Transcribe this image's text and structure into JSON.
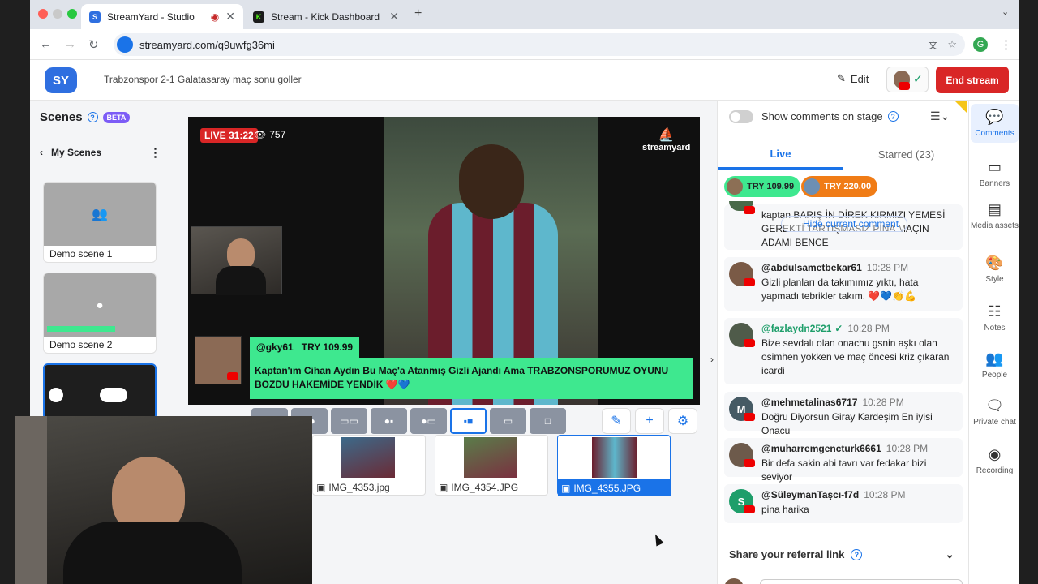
{
  "browser": {
    "tabs": [
      {
        "label": "StreamYard - Studio",
        "favicon": "S",
        "active": true
      },
      {
        "label": "Stream - Kick Dashboard",
        "favicon": "K",
        "active": false
      }
    ],
    "url": "streamyard.com/q9uwfg36mi",
    "profile_initial": "G"
  },
  "header": {
    "broadcast_title": "Trabzonspor 2-1 Galatasaray maç sonu goller",
    "edit_label": "Edit",
    "end_stream_label": "End stream"
  },
  "scenes": {
    "title": "Scenes",
    "beta_label": "BETA",
    "my_scenes_label": "My Scenes",
    "items": [
      {
        "name": "Demo scene 1"
      },
      {
        "name": "Demo scene 2"
      }
    ]
  },
  "stage": {
    "live_label": "LIVE 31:22",
    "viewers": "757",
    "watermark": "streamyard",
    "banner": {
      "handle": "@gky61",
      "amount": "TRY 109.99",
      "message": "Kaptan'ım Cihan Aydın Bu Maç'a Atanmış Gizli Ajandı Ama TRABZONSPORUMUZ OYUNU BOZDU HAKEMİDE YENDİK ❤️💙"
    }
  },
  "media": [
    {
      "name": "IMG_4353.jpg",
      "selected": false
    },
    {
      "name": "IMG_4354.JPG",
      "selected": false
    },
    {
      "name": "IMG_4355.JPG",
      "selected": true
    }
  ],
  "chat": {
    "show_on_stage_label": "Show comments on stage",
    "tabs": [
      {
        "label": "Live",
        "active": true
      },
      {
        "label": "Starred (23)",
        "active": false
      }
    ],
    "pills": [
      {
        "amount": "TRY 109.99",
        "color": "#3ee88f"
      },
      {
        "amount": "TRY 220.00",
        "color": "#f07c16"
      }
    ],
    "partial_message": "kaptan BARIŞ İN DİREK KIRMIZI YEMESİ GEREKTİ TARTIŞMASIZ PİNA MAÇIN ADAMI BENCE",
    "hide_comment_label": "Hide current comment",
    "messages": [
      {
        "user": "@abdulsametbekar61",
        "time": "10:28 PM",
        "text": "Gizli planları da takımımız yıktı, hata yapmadı tebrikler takım. ❤️💙👏💪",
        "avatar": "",
        "avatar_color": "#7a5a46"
      },
      {
        "user": "@fazlaydn2521",
        "time": "10:28 PM",
        "text": "Bize sevdalı olan onachu gsnin aşkı olan osimhen yokken ve maç öncesi kriz çıkaran icardi",
        "avatar": "",
        "avatar_color": "#4f5b4a"
      },
      {
        "user": "@mehmetalinas6717",
        "time": "10:28 PM",
        "text": "Doğru Diyorsun Giray Kardeşim En iyisi Onacu",
        "avatar": "M",
        "avatar_color": "#455a64"
      },
      {
        "user": "@muharremgencturk6661",
        "time": "10:28 PM",
        "text": "Bir defa sakin abi tavrı var fedakar bizi seviyor",
        "avatar": "",
        "avatar_color": "#6d5a4b"
      },
      {
        "user": "@SüleymanTaşcı-f7d",
        "time": "10:28 PM",
        "text": "pina harika",
        "avatar": "S",
        "avatar_color": "#1e9e6a"
      }
    ],
    "referral_label": "Share your referral link"
  },
  "rail": [
    {
      "label": "Comments",
      "icon": "comment-icon",
      "active": true
    },
    {
      "label": "Banners",
      "icon": "banner-icon",
      "active": false
    },
    {
      "label": "Media assets",
      "icon": "media-icon",
      "active": false
    },
    {
      "label": "Style",
      "icon": "palette-icon",
      "active": false
    },
    {
      "label": "Notes",
      "icon": "notes-icon",
      "active": false
    },
    {
      "label": "People",
      "icon": "people-icon",
      "active": false
    },
    {
      "label": "Private chat",
      "icon": "private-chat-icon",
      "active": false
    },
    {
      "label": "Recording",
      "icon": "record-icon",
      "active": false
    }
  ]
}
